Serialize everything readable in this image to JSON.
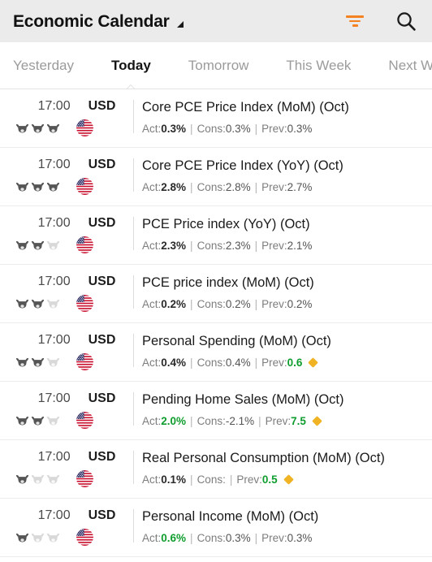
{
  "appbar": {
    "title": "Economic Calendar",
    "title_caret_icon": "caret-down-icon",
    "filter_icon": "filter-icon",
    "search_icon": "search-icon",
    "accent_color": "#f58220"
  },
  "tabs": {
    "items": [
      {
        "label": "Yesterday",
        "active": false
      },
      {
        "label": "Today",
        "active": true
      },
      {
        "label": "Tomorrow",
        "active": false
      },
      {
        "label": "This Week",
        "active": false
      },
      {
        "label": "Next Week",
        "active": false
      }
    ]
  },
  "labels": {
    "act": "Act:",
    "cons": "Cons:",
    "prev": "Prev:",
    "separator": "|"
  },
  "colors": {
    "green": "#0f9d2e",
    "diamond": "#f0b323",
    "muted": "#7d7d7d"
  },
  "events": [
    {
      "time": "17:00",
      "currency": "USD",
      "flag": "us-flag-icon",
      "volatility": 3,
      "title": "Core PCE Price Index (MoM) (Oct)",
      "act": "0.3%",
      "act_color": "dark",
      "cons": "0.3%",
      "prev": "0.3%",
      "prev_color": "muted",
      "revised": false
    },
    {
      "time": "17:00",
      "currency": "USD",
      "flag": "us-flag-icon",
      "volatility": 3,
      "title": "Core PCE Price Index (YoY) (Oct)",
      "act": "2.8%",
      "act_color": "dark",
      "cons": "2.8%",
      "prev": "2.7%",
      "prev_color": "muted",
      "revised": false
    },
    {
      "time": "17:00",
      "currency": "USD",
      "flag": "us-flag-icon",
      "volatility": 2,
      "title": "PCE Price index (YoY) (Oct)",
      "act": "2.3%",
      "act_color": "dark",
      "cons": "2.3%",
      "prev": "2.1%",
      "prev_color": "muted",
      "revised": false
    },
    {
      "time": "17:00",
      "currency": "USD",
      "flag": "us-flag-icon",
      "volatility": 2,
      "title": "PCE price index (MoM) (Oct)",
      "act": "0.2%",
      "act_color": "dark",
      "cons": "0.2%",
      "prev": "0.2%",
      "prev_color": "muted",
      "revised": false
    },
    {
      "time": "17:00",
      "currency": "USD",
      "flag": "us-flag-icon",
      "volatility": 2,
      "title": "Personal Spending (MoM) (Oct)",
      "act": "0.4%",
      "act_color": "dark",
      "cons": "0.4%",
      "prev": "0.6",
      "prev_color": "green",
      "revised": true
    },
    {
      "time": "17:00",
      "currency": "USD",
      "flag": "us-flag-icon",
      "volatility": 2,
      "title": "Pending Home Sales (MoM) (Oct)",
      "act": "2.0%",
      "act_color": "green",
      "cons": "-2.1%",
      "prev": "7.5",
      "prev_color": "green",
      "revised": true
    },
    {
      "time": "17:00",
      "currency": "USD",
      "flag": "us-flag-icon",
      "volatility": 1,
      "title": "Real Personal Consumption (MoM) (Oct)",
      "act": "0.1%",
      "act_color": "dark",
      "cons": "",
      "prev": "0.5",
      "prev_color": "green",
      "revised": true
    },
    {
      "time": "17:00",
      "currency": "USD",
      "flag": "us-flag-icon",
      "volatility": 1,
      "title": "Personal Income (MoM) (Oct)",
      "act": "0.6%",
      "act_color": "green",
      "cons": "0.3%",
      "prev": "0.3%",
      "prev_color": "muted",
      "revised": false
    }
  ]
}
